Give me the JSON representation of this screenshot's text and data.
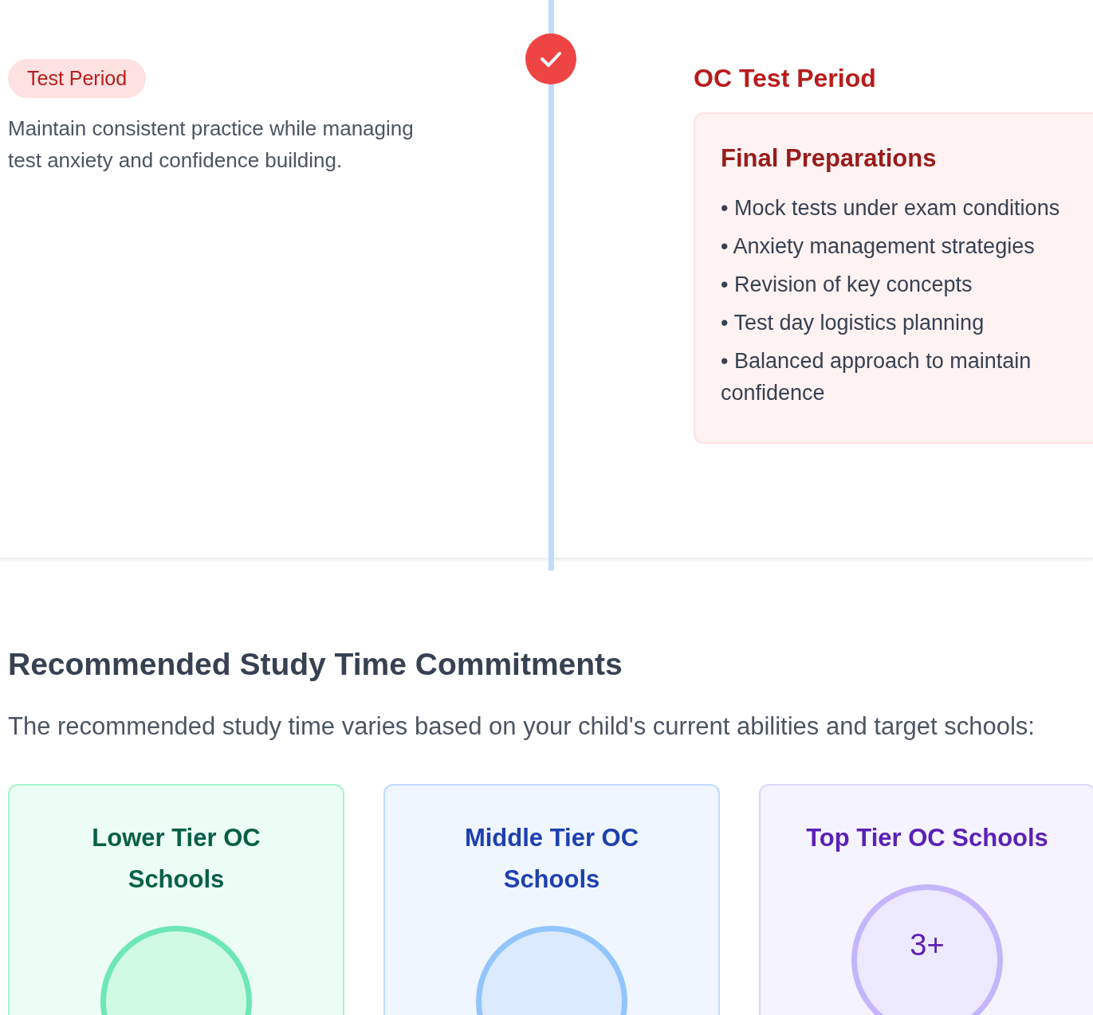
{
  "timeline": {
    "step": {
      "badge": "Test Period",
      "description": "Maintain consistent practice while managing test anxiety and confidence building.",
      "completed": true,
      "title": "OC Test Period",
      "card": {
        "heading": "Final Preparations",
        "items": [
          "• Mock tests under exam conditions",
          "• Anxiety management strategies",
          "• Revision of key concepts",
          "• Test day logistics planning",
          "• Balanced approach to maintain confidence"
        ]
      }
    }
  },
  "study_time": {
    "heading": "Recommended Study Time Commitments",
    "intro": "The recommended study time varies based on your child's current abilities and target schools:",
    "tiers": [
      {
        "kind": "lower",
        "title": "Lower Tier OC Schools"
      },
      {
        "kind": "middle",
        "title": "Middle Tier OC Schools"
      },
      {
        "kind": "top",
        "title": "Top Tier OC Schools",
        "hours": "3+"
      }
    ]
  }
}
